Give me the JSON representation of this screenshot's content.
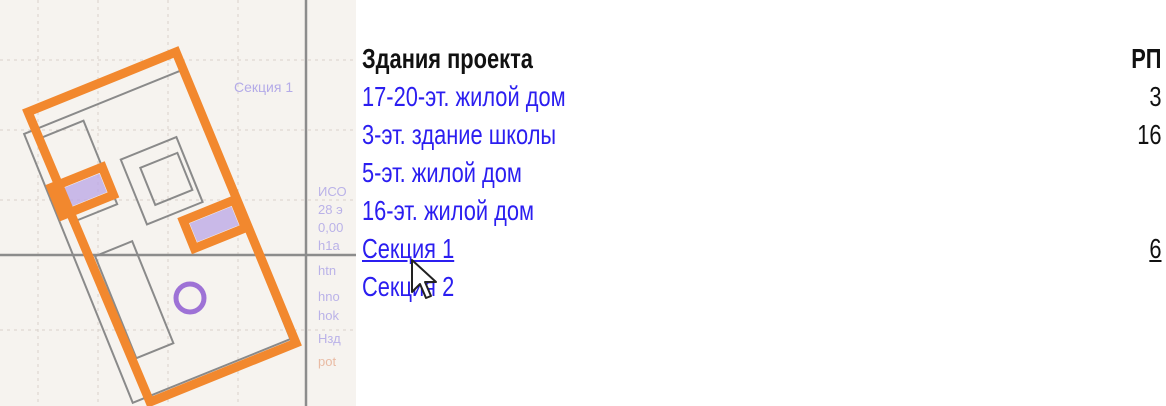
{
  "header": {
    "title": "Здания проекта",
    "column": "РП"
  },
  "buildings": [
    {
      "name": "17-20-эт. жилой дом",
      "value": "3"
    },
    {
      "name": "3-эт. здание школы",
      "value": "16"
    },
    {
      "name": "5-эт. жилой дом",
      "value": ""
    },
    {
      "name": "16-эт. жилой дом",
      "value": ""
    },
    {
      "name": "Секция 1",
      "value": "6"
    },
    {
      "name": "Секция 2",
      "value": ""
    }
  ],
  "map": {
    "section_label": "Секция 1",
    "side_text": [
      "ИСО",
      "28 э",
      "0,00",
      "h1a",
      "htn",
      "hno",
      "hok",
      "Нзд",
      "pot"
    ]
  },
  "colors": {
    "link": "#2b1ef0",
    "outline": "#f2882e",
    "highlight": "#b9a6e6",
    "marker": "#9e72d6"
  },
  "icons": {
    "cursor": "arrow-cursor-icon"
  }
}
